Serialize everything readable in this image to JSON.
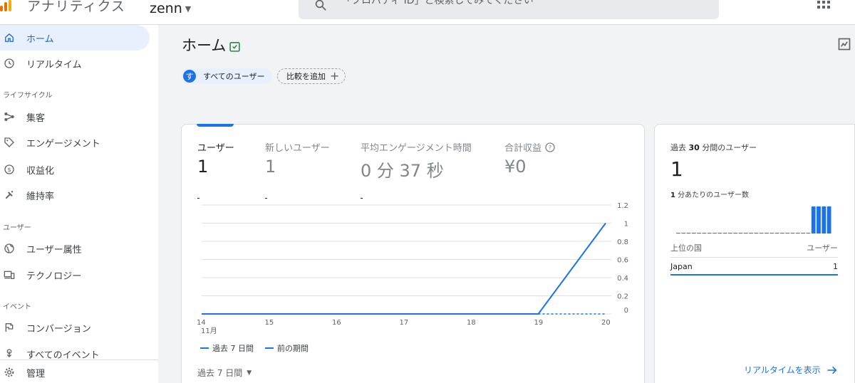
{
  "header": {
    "app_title": "アナリティクス",
    "account_name": "zenn",
    "search_placeholder": "「プロパティ ID」と検索してみてください"
  },
  "sidebar": {
    "items": [
      {
        "label": "ホーム",
        "icon": "home-icon",
        "active": true
      },
      {
        "label": "リアルタイム",
        "icon": "clock-icon"
      }
    ],
    "sections": [
      {
        "label": "ライフサイクル",
        "items": [
          {
            "label": "集客",
            "icon": "acquisition-icon"
          },
          {
            "label": "エンゲージメント",
            "icon": "tag-icon"
          },
          {
            "label": "収益化",
            "icon": "dollar-icon"
          },
          {
            "label": "維持率",
            "icon": "magnet-icon"
          }
        ]
      },
      {
        "label": "ユーザー",
        "items": [
          {
            "label": "ユーザー属性",
            "icon": "globe-icon"
          },
          {
            "label": "テクノロジー",
            "icon": "devices-icon"
          }
        ]
      },
      {
        "label": "イベント",
        "items": [
          {
            "label": "コンバージョン",
            "icon": "flag-icon"
          },
          {
            "label": "すべてのイベント",
            "icon": "touch-icon"
          }
        ]
      }
    ],
    "admin_label": "管理"
  },
  "main": {
    "title": "ホーム",
    "segment_chip": {
      "avatar": "す",
      "label": "すべてのユーザー"
    },
    "compare_chip": "比較を追加",
    "metrics": [
      {
        "label": "ユーザー",
        "value": "1",
        "active": true
      },
      {
        "label": "新しいユーザー",
        "value": "1"
      },
      {
        "label": "平均エンゲージメント時間",
        "value": "0 分 37 秒"
      },
      {
        "label": "合計収益",
        "value": "¥0",
        "help": true
      }
    ],
    "legend": {
      "current": "過去 7 日間",
      "previous": "前の期間"
    },
    "date_range": "過去 7 日間"
  },
  "chart_data": {
    "type": "line",
    "categories": [
      "14",
      "15",
      "16",
      "17",
      "18",
      "19",
      "20"
    ],
    "x_sublabel": "11月",
    "ylim": [
      0,
      1.2
    ],
    "yticks": [
      "0",
      "0.2",
      "0.4",
      "0.6",
      "0.8",
      "1",
      "1.2"
    ],
    "grid": true,
    "legend_position": "bottom-left",
    "series": [
      {
        "name": "過去 7 日間",
        "values": [
          0,
          0,
          0,
          0,
          0,
          0,
          1
        ],
        "style": "solid",
        "color": "#1a73e8"
      },
      {
        "name": "前の期間",
        "values": [
          null,
          null,
          null,
          null,
          null,
          0,
          0
        ],
        "style": "dashed",
        "color": "#1a73e8"
      }
    ]
  },
  "realtime": {
    "title_prefix": "過去",
    "title_number": "30",
    "title_suffix": "分間のユーザー",
    "value": "1",
    "sub_number": "1",
    "sub_suffix": "分あたりのユーザー数",
    "col_country": "上位の国",
    "col_users": "ユーザー",
    "rows": [
      {
        "country": "Japan",
        "users": "1"
      }
    ],
    "link": "リアルタイムを表示",
    "bars": [
      0,
      0,
      0,
      0,
      0,
      0,
      0,
      0,
      0,
      0,
      0,
      0,
      0,
      0,
      0,
      0,
      0,
      0,
      0,
      0,
      0,
      0,
      0,
      0,
      0,
      0,
      1,
      1,
      1,
      1
    ]
  },
  "colors": {
    "accent": "#1a73e8",
    "active_nav_bg": "#e8f0fe",
    "verified": "#1e8e3e"
  }
}
